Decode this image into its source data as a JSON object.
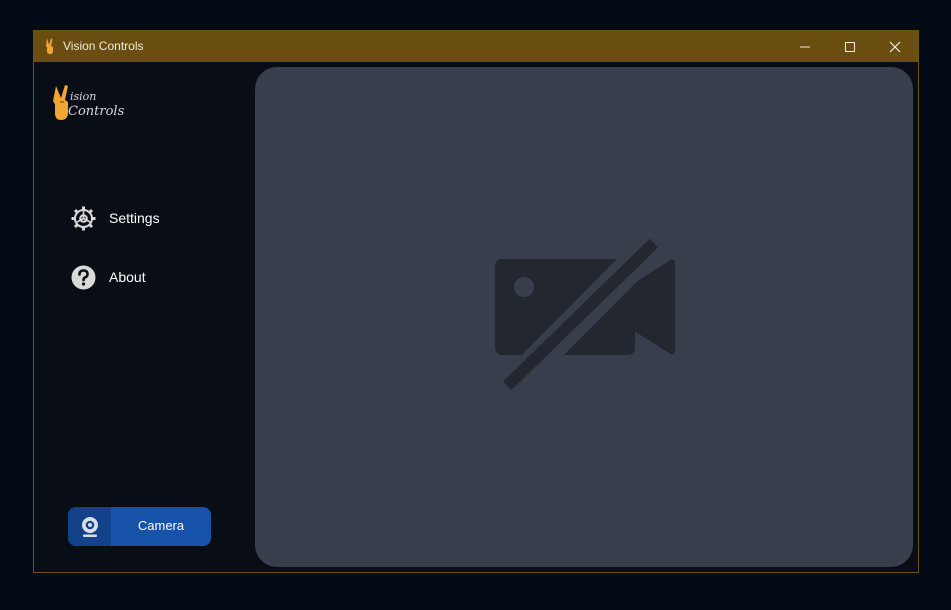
{
  "window": {
    "title": "Vision Controls",
    "titlebar_color": "#6a4d10",
    "controls": [
      "minimize-icon",
      "maximize-icon",
      "close-icon"
    ]
  },
  "sidebar": {
    "logo": {
      "text_line1": "ision",
      "text_line2": "Controls",
      "icon": "peace-hand-icon"
    },
    "items": [
      {
        "label": "Settings",
        "icon": "gear-icon"
      },
      {
        "label": "About",
        "icon": "question-icon"
      }
    ],
    "camera_button": {
      "label": "Camera",
      "icon": "webcam-icon",
      "color": "#1753a8"
    }
  },
  "main": {
    "viewport_state_icon": "video-off-icon",
    "viewport_color": "#383e4b"
  }
}
